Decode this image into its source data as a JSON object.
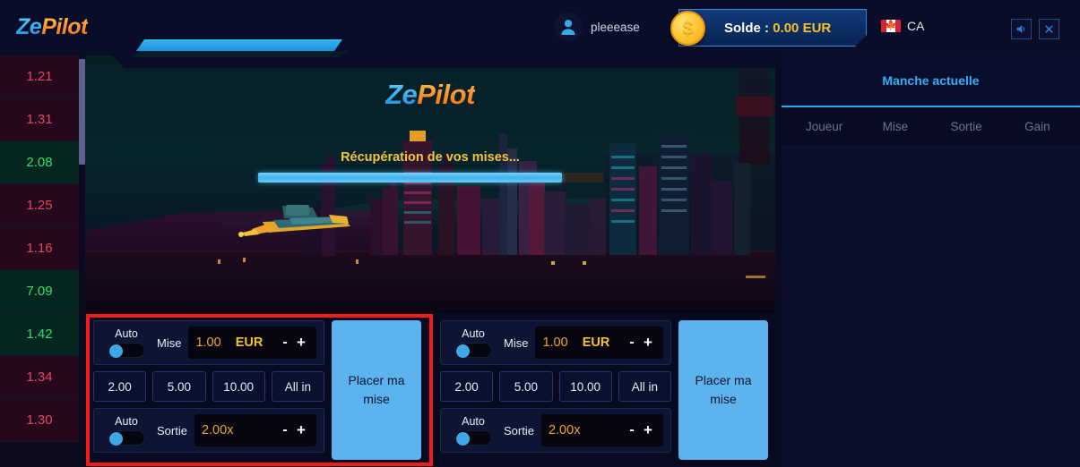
{
  "header": {
    "logo_ze": "Ze",
    "logo_pilot": "Pilot",
    "username": "pleeease",
    "balance_label": "Solde :",
    "balance_amount": "0.00",
    "balance_currency": "EUR",
    "locale": "CA",
    "sound_icon": "speaker-icon",
    "close_icon": "close-icon",
    "accent_blue": "#2aa8ef",
    "accent_gold": "#f6c53a"
  },
  "history": {
    "items": [
      {
        "value": "1.21",
        "state": "red"
      },
      {
        "value": "1.31",
        "state": "red"
      },
      {
        "value": "2.08",
        "state": "green"
      },
      {
        "value": "1.25",
        "state": "red"
      },
      {
        "value": "1.16",
        "state": "red"
      },
      {
        "value": "7.09",
        "state": "green"
      },
      {
        "value": "1.42",
        "state": "green"
      },
      {
        "value": "1.34",
        "state": "red"
      },
      {
        "value": "1.30",
        "state": "red"
      }
    ]
  },
  "game": {
    "logo_ze": "Ze",
    "logo_pilot": "Pilot",
    "status_text": "Récupération de vos mises...",
    "progress_percent": 88
  },
  "right_panel": {
    "tab_label": "Manche actuelle",
    "columns": [
      "Joueur",
      "Mise",
      "Sortie",
      "Gain"
    ],
    "rows": []
  },
  "bet_panels": [
    {
      "auto_bet_label": "Auto",
      "auto_bet_on": false,
      "stake_label": "Mise",
      "stake_value": "1.00",
      "stake_currency": "EUR",
      "minus_label": "-",
      "plus_label": "+",
      "quick_amounts": [
        "2.00",
        "5.00",
        "10.00",
        "All in"
      ],
      "auto_cashout_label": "Auto",
      "auto_cashout_on": false,
      "cashout_label": "Sortie",
      "cashout_value": "2.00x",
      "place_bet_label": "Placer ma mise",
      "highlighted": true
    },
    {
      "auto_bet_label": "Auto",
      "auto_bet_on": false,
      "stake_label": "Mise",
      "stake_value": "1.00",
      "stake_currency": "EUR",
      "minus_label": "-",
      "plus_label": "+",
      "quick_amounts": [
        "2.00",
        "5.00",
        "10.00",
        "All in"
      ],
      "auto_cashout_label": "Auto",
      "auto_cashout_on": false,
      "cashout_label": "Sortie",
      "cashout_value": "2.00x",
      "place_bet_label": "Placer ma mise",
      "highlighted": false
    }
  ]
}
